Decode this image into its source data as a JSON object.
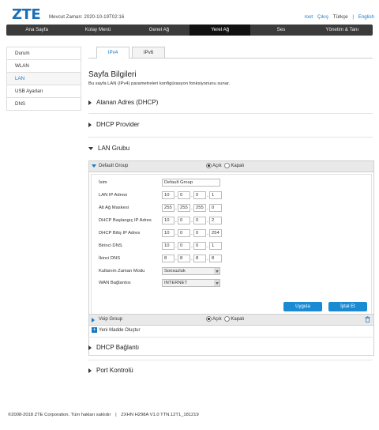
{
  "header": {
    "logo": "ZTE",
    "time_label": "Mevcut Zaman: 2020-10-19T02:16",
    "user": "root",
    "logout": "Çıkış",
    "lang_tr": "Türkçe",
    "separator": "|",
    "lang_en": "English"
  },
  "nav": [
    "Ana Sayfa",
    "Kolay Menü",
    "Genel Ağ",
    "Yerel Ağ",
    "Ses",
    "Yönetim & Tanı"
  ],
  "sidebar": [
    "Durum",
    "WLAN",
    "LAN",
    "USB Ayarları",
    "DNS"
  ],
  "tabs": [
    "IPv4",
    "IPv6"
  ],
  "page": {
    "title": "Sayfa Bilgileri",
    "desc": "Bu sayfa LAN (IPv4) parametreleri konfigürasyon fonksiyonunu sunar."
  },
  "sections": {
    "assigned": "Atanan Adres (DHCP)",
    "provider": "DHCP Provider",
    "lan_group": "LAN Grubu",
    "dhcp_conn": "DHCP Bağlantı",
    "port": "Port Kontrolü"
  },
  "group": {
    "name": "Default Group",
    "on": "Açık",
    "off": "Kapalı",
    "labels": {
      "name": "İsim",
      "lan_ip": "LAN IP Adresi",
      "mask": "Alt Ağ Maskesi",
      "dhcp_start": "DHCP Başlangıç IP Adres",
      "dhcp_end": "DHCP Bitiş IP Adres",
      "dns1": "Birinci DNS",
      "dns2": "İkinci DNS",
      "lease": "Kullanım Zaman Modu",
      "wan": "WAN Bağlantısı"
    },
    "values": {
      "name": "Default Group",
      "lan_ip": [
        "10",
        "0",
        "0",
        "1"
      ],
      "mask": [
        "255",
        "255",
        "255",
        "0"
      ],
      "dhcp_start": [
        "10",
        "0",
        "0",
        "2"
      ],
      "dhcp_end": [
        "10",
        "0",
        "0",
        "254"
      ],
      "dns1": [
        "10",
        "0",
        "0",
        "1"
      ],
      "dns2": [
        "8",
        "8",
        "8",
        "8"
      ],
      "lease": "Sonsuzluk",
      "wan": "INTERNET"
    },
    "apply": "Uygula",
    "cancel": "İptal Et"
  },
  "voip": {
    "name": "Voip Group",
    "on": "Açık",
    "off": "Kapalı"
  },
  "new_item": "Yeni Madde Oluştur",
  "footer": {
    "copyright": "©2008-2018 ZTE Corporation. Tüm hakları saklıdır",
    "sep": "|",
    "version": "ZXHN H298A V1.0 TTN.12T1_181219"
  },
  "colors": {
    "accent": "#1a78c2",
    "nav_bg": "#3b3b3b",
    "button": "#1a8ad3"
  }
}
